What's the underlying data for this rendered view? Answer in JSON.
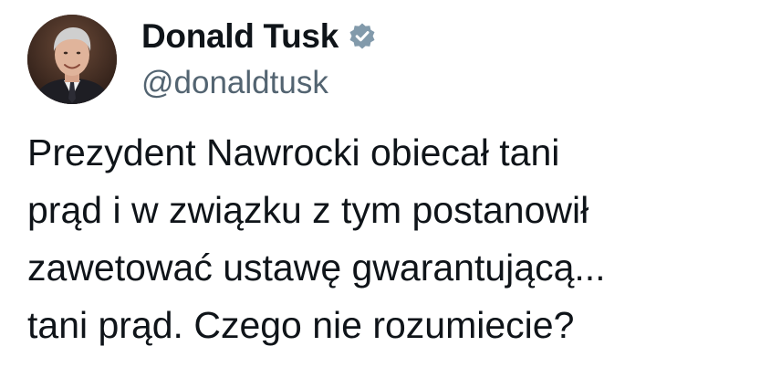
{
  "author": {
    "display_name": "Donald Tusk",
    "handle": "@donaldtusk",
    "verified_icon": "verified-badge-icon",
    "avatar": "profile-photo"
  },
  "tweet": {
    "lines": [
      "Prezydent Nawrocki obiecał tani",
      "prąd i w związku z tym postanowił",
      "zawetować ustawę gwarantującą...",
      "tani prąd. Czego nie rozumiecie?"
    ]
  },
  "colors": {
    "text": "#0f1419",
    "secondary": "#536471",
    "badge": "#829aab",
    "background": "#ffffff"
  }
}
